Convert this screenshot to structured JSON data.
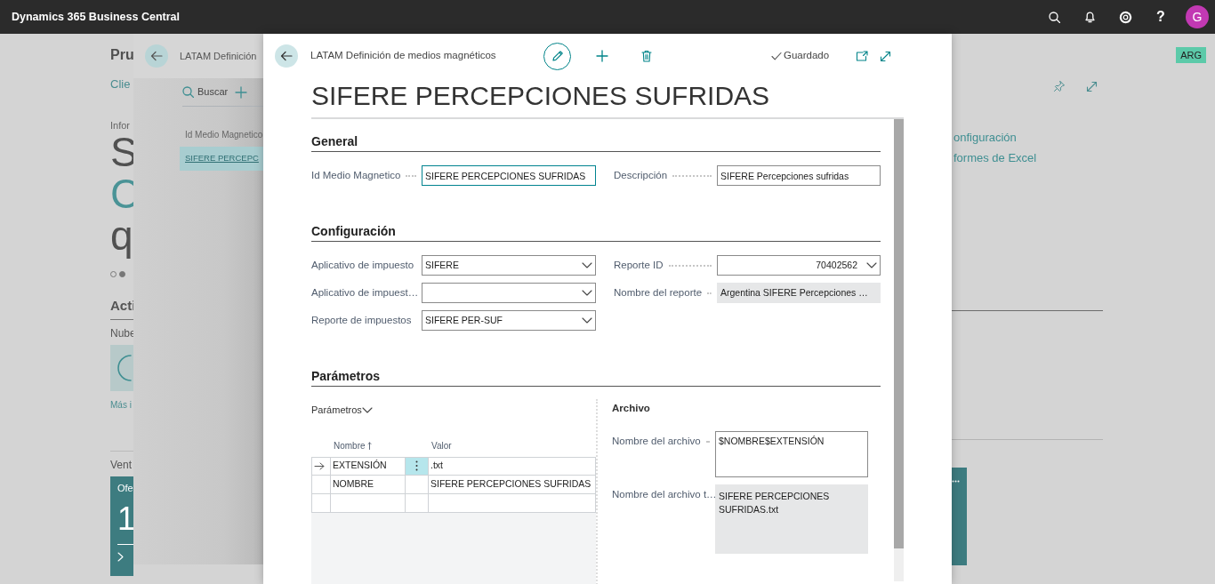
{
  "app_bar": {
    "title": "Dynamics 365 Business Central",
    "help": "?",
    "avatar_initial": "G"
  },
  "background_page": {
    "title": "Pru",
    "link": "Clie",
    "caption": "Infor",
    "headline_lines": [
      {
        "text": "S",
        "accent": false
      },
      {
        "text": "C",
        "accent": true
      },
      {
        "text": "q",
        "accent": false
      }
    ],
    "carousel_dots": [
      {
        "selected": false
      },
      {
        "selected": true
      }
    ],
    "actions_heading": "Acti",
    "cloud_label": "Nube",
    "more_link": "Más i",
    "sales_heading": "Vent",
    "tile": {
      "label": "Ofe",
      "value": "1"
    },
    "links": [
      "onfiguración",
      "formes de Excel"
    ],
    "company_badge": "ARG"
  },
  "list_page": {
    "breadcrumb": "LATAM Definición",
    "search": "Buscar",
    "column": "Id Medio Magnetico",
    "rows": [
      {
        "value": "SIFERE PERCEPC",
        "selected": true
      }
    ]
  },
  "card": {
    "breadcrumb": "LATAM Definición de medios magnéticos",
    "status": "Guardado",
    "title": "SIFERE PERCEPCIONES SUFRIDAS",
    "sections": [
      {
        "kind": "fields",
        "title": "General",
        "left": [
          {
            "label": "Id Medio Magnetico",
            "value": "SIFERE PERCEPCIONES SUFRIDAS",
            "kind": "text",
            "focused": true
          }
        ],
        "right": [
          {
            "label": "Descripción",
            "value": "SIFERE Percepciones sufridas",
            "kind": "text",
            "focused": false
          }
        ]
      },
      {
        "kind": "fields",
        "title": "Configuración",
        "left": [
          {
            "label": "Aplicativo de impuesto",
            "value": "SIFERE",
            "kind": "dropdown",
            "focused": false
          },
          {
            "label": "Aplicativo de impuest…",
            "kind": "dropdown",
            "focused": false
          },
          {
            "label": "Reporte de impuestos",
            "value": "SIFERE PER-SUF",
            "kind": "dropdown",
            "focused": false
          }
        ],
        "right": [
          {
            "label": "Reporte ID",
            "value": "70402562",
            "kind": "number_dropdown",
            "focused": false
          },
          {
            "label": "Nombre del reporte",
            "value": "Argentina SIFERE Percepciones …",
            "kind": "readonly",
            "focused": false
          }
        ]
      },
      {
        "kind": "parameters",
        "title": "Parámetros",
        "part": {
          "title": "Parámetros",
          "expanded": true,
          "columns": [
            {
              "label": "Nombre",
              "sorted": true
            },
            {
              "label": "Valor",
              "sorted": false
            }
          ],
          "rows": [
            {
              "name": "EXTENSIÓN",
              "value": ".txt",
              "current": true
            },
            {
              "name": "NOMBRE",
              "value": "SIFERE PERCEPCIONES SUFRIDAS",
              "current": false
            }
          ]
        },
        "group": {
          "title": "Archivo",
          "fields": [
            {
              "label": "Nombre del archivo",
              "value": "$NOMBRE$EXTENSIÓN",
              "kind": "textarea",
              "focused": false
            },
            {
              "label": "Nombre del archivo t…",
              "value": "SIFERE PERCEPCIONES SUFRIDAS.txt",
              "kind": "readonly_multiline",
              "focused": false
            }
          ]
        }
      }
    ]
  }
}
